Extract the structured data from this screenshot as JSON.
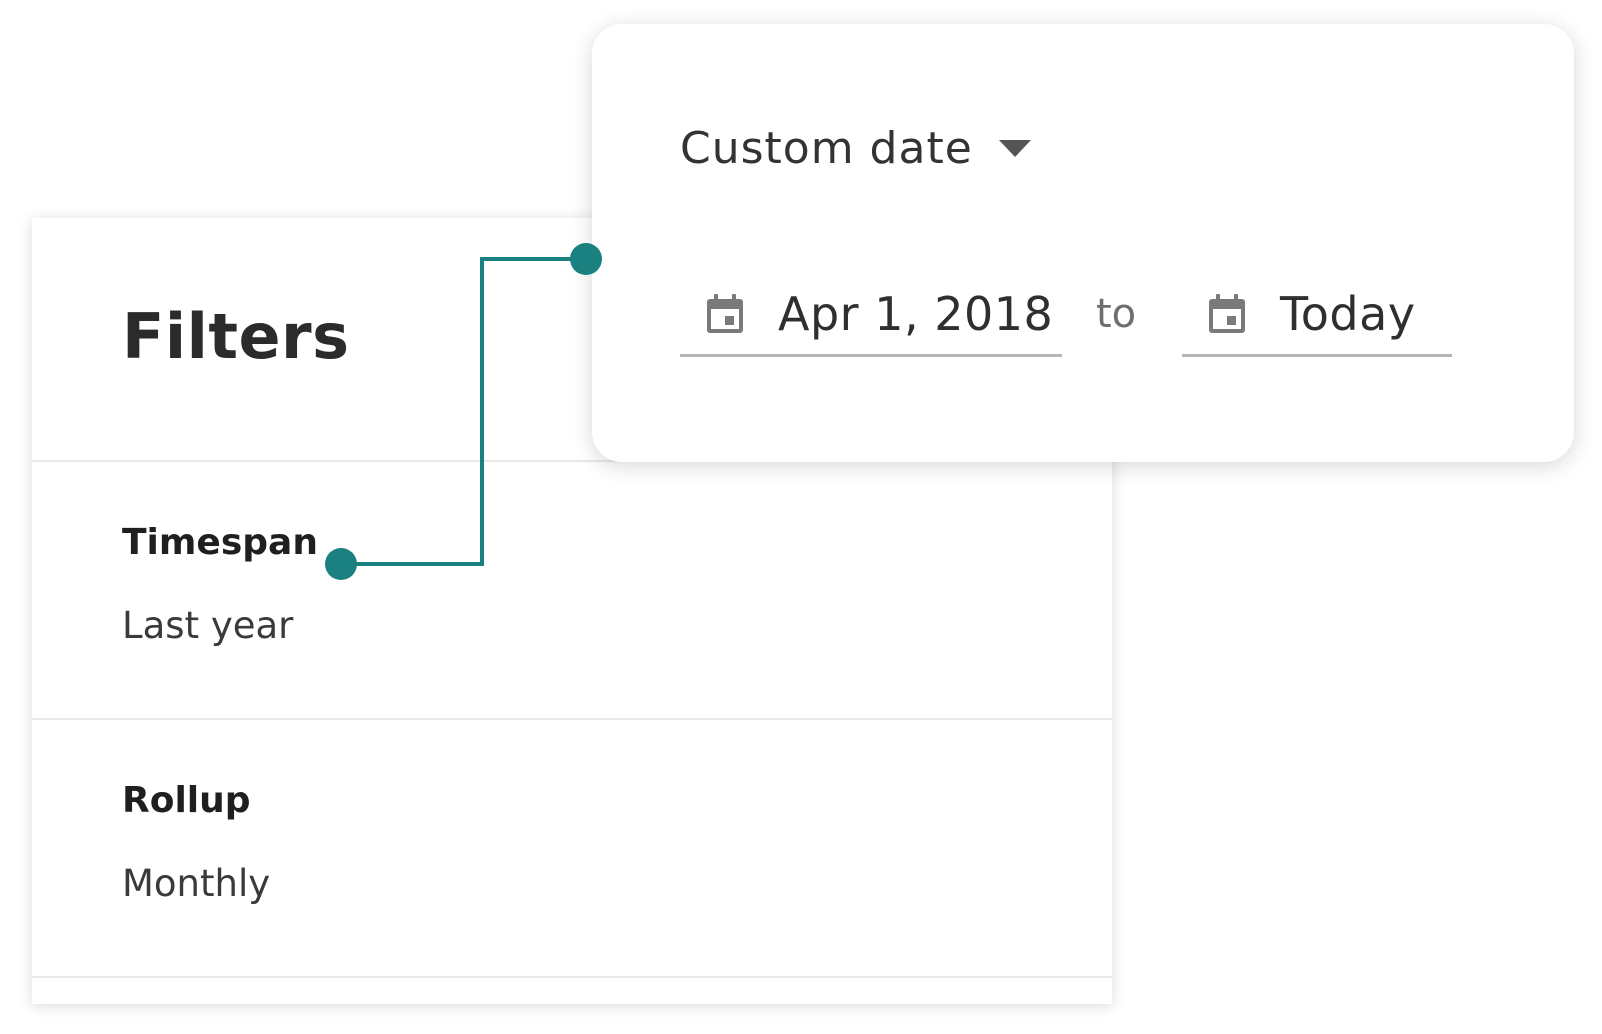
{
  "filters": {
    "title": "Filters",
    "sections": [
      {
        "label": "Timespan",
        "value": "Last year"
      },
      {
        "label": "Rollup",
        "value": "Monthly"
      }
    ]
  },
  "date_picker": {
    "type_label": "Custom date",
    "start_date": "Apr 1, 2018",
    "separator": "to",
    "end_date": "Today"
  },
  "icons": {
    "dropdown": "chevron-down-icon",
    "calendar": "calendar-icon"
  },
  "colors": {
    "accent": "#1a8080",
    "text_primary": "#1f1f1f",
    "text_secondary": "#3a3a3a",
    "icon_gray": "#7a7a7a",
    "divider": "#e8e8e8",
    "underline": "#b5b5b5"
  }
}
